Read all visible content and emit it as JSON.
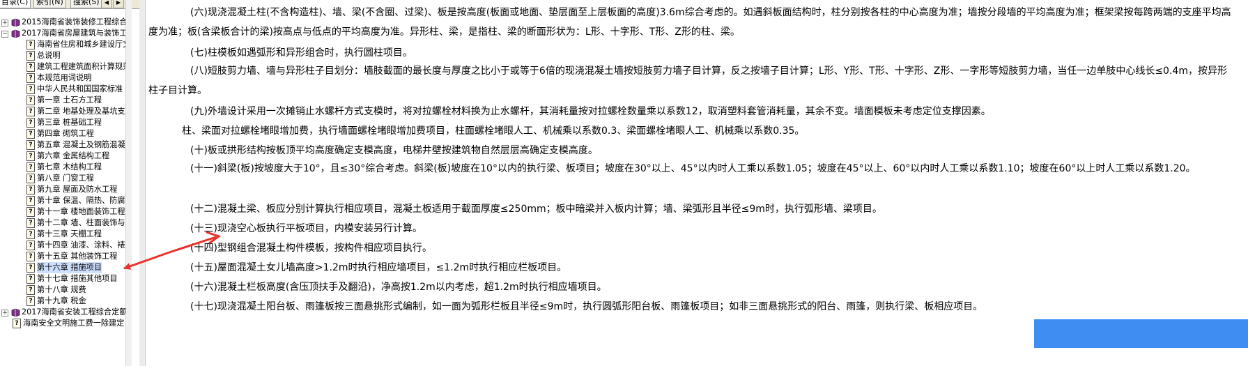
{
  "tabs": [
    "目录(C)",
    "索引(N)",
    "搜索(S)"
  ],
  "tab_nav": [
    "◀",
    "▶"
  ],
  "tree": [
    {
      "expander": "+",
      "icon": "book-icon",
      "label": "2015海南省装饰装修工程综合",
      "indent": 0
    },
    {
      "expander": "−",
      "icon": "book-open-icon",
      "label": "2017海南省房屋建筑与装饰工",
      "indent": 0
    },
    {
      "icon": "help-icon",
      "label": "海南省住房和城乡建设厅文",
      "indent": 1
    },
    {
      "icon": "help-icon",
      "label": "总说明",
      "indent": 1
    },
    {
      "icon": "help-icon",
      "label": "建筑工程建筑面积计算规范",
      "indent": 1
    },
    {
      "icon": "help-icon",
      "label": "本规范用词说明",
      "indent": 1
    },
    {
      "icon": "help-icon",
      "label": "中华人民共和国国家标准",
      "indent": 1
    },
    {
      "icon": "help-icon",
      "label": "第一章 土石方工程",
      "indent": 1
    },
    {
      "icon": "help-icon",
      "label": "第二章 地基处理及基坑支",
      "indent": 1
    },
    {
      "icon": "help-icon",
      "label": "第三章 桩基础工程",
      "indent": 1
    },
    {
      "icon": "help-icon",
      "label": "第四章 砌筑工程",
      "indent": 1
    },
    {
      "icon": "help-icon",
      "label": "第五章 混凝土及钢筋混凝",
      "indent": 1
    },
    {
      "icon": "help-icon",
      "label": "第六章 金属结构工程",
      "indent": 1
    },
    {
      "icon": "help-icon",
      "label": "第七章 木结构工程",
      "indent": 1
    },
    {
      "icon": "help-icon",
      "label": "第八章 门窗工程",
      "indent": 1
    },
    {
      "icon": "help-icon",
      "label": "第九章 屋面及防水工程",
      "indent": 1
    },
    {
      "icon": "help-icon",
      "label": "第十章 保温、隔热、防腐",
      "indent": 1
    },
    {
      "icon": "help-icon",
      "label": "第十一章 楼地面装饰工程",
      "indent": 1
    },
    {
      "icon": "help-icon",
      "label": "第十二章 墙、柱面装饰与",
      "indent": 1
    },
    {
      "icon": "help-icon",
      "label": "第十三章 天棚工程",
      "indent": 1
    },
    {
      "icon": "help-icon",
      "label": "第十四章 油漆、涂料、裱",
      "indent": 1
    },
    {
      "icon": "help-icon",
      "label": "第十五章 其他装饰工程",
      "indent": 1
    },
    {
      "icon": "help-icon",
      "label": "第十六章 措施项目",
      "indent": 1,
      "selected": true
    },
    {
      "icon": "help-icon",
      "label": "第十七章 措施其他项目",
      "indent": 1
    },
    {
      "icon": "help-icon",
      "label": "第十八章 规费",
      "indent": 1
    },
    {
      "icon": "help-icon",
      "label": "第十九章 税金",
      "indent": 1
    },
    {
      "expander": "+",
      "icon": "book-icon",
      "label": "2017海南省安装工程综合定额",
      "indent": 0
    },
    {
      "icon": "help-icon",
      "label": "海南安全文明施工费一除建定",
      "indent": 0
    }
  ],
  "paragraphs": [
    "(六)现浇混凝土柱(不含构造柱)、墙、梁(不含圈、过梁)、板是按高度(板面或地面、垫层面至上层板面的高度)3.6m综合考虑的。如遇斜板面结构时，柱分别按各柱的中心高度为准；墙按分段墙的平均高度为准；框架梁按每跨两端的支座平均高度为准；板(含梁板合计的梁)按高点与低点的平均高度为准。异形柱、梁，是指柱、梁的断面形状为：L形、十字形、T形、Z形的柱、梁。",
    "(七)柱模板如遇弧形和异形组合时，执行圆柱项目。",
    "(八)短肢剪力墙、墙与异形柱子目划分：墙肢截面的最长度与厚度之比小于或等于6倍的现浇混凝土墙按短肢剪力墙子目计算，反之按墙子目计算；L形、Y形、T形、十字形、Z形、一字形等短肢剪力墙，当任一边单肢中心线长≤0.4m，按异形柱子目计算。",
    "(九)外墙设计采用一次摊销止水螺杆方式支模时，将对拉螺栓材料换为止水螺杆，其消耗量按对拉螺栓数量乘以系数12，取消塑料套管消耗量，其余不变。墙面模板未考虑定位支撑因素。",
    "柱、梁面对拉螺栓堵眼增加费，执行墙面螺栓堵眼增加费项目，柱面螺栓堵眼人工、机械乘以系数0.3、梁面螺栓堵眼人工、机械乘以系数0.35。",
    "(十)板或拱形结构按板顶平均高度确定支模高度，电梯井壁按建筑物自然层层高确定支模高度。",
    "(十一)斜梁(板)按坡度大于10°，且≤30°综合考虑。斜梁(板)坡度在10°以内的执行梁、板项目；坡度在30°以上、45°以内时人工乘以系数1.05；坡度在45°以上、60°以内时人工乘以系数1.10；坡度在60°以上时人工乘以系数1.20。",
    "(十二)混凝土梁、板应分别计算执行相应项目，混凝土板适用于截面厚度≤250mm；板中暗梁并入板内计算；墙、梁弧形且半径≤9m时，执行弧形墙、梁项目。",
    "(十三)现浇空心板执行平板项目，内模安装另行计算。",
    "(十四)型钢组合混凝土构件模板，按构件相应项目执行。",
    "(十五)屋面混凝土女儿墙高度>1.2m时执行相应墙项目，≤1.2m时执行相应栏板项目。",
    "(十六)混凝土栏板高度(含压顶扶手及翻沿)，净高按1.2m以内考虑，超1.2m时执行相应墙项目。",
    "(十七)现浇混凝土阳台板、雨篷板按三面悬挑形式编制，如一面为弧形栏板且半径≤9m时，执行圆弧形阳台板、雨篷板项目；如非三面悬挑形式的阳台、雨篷，则执行梁、板相应项目。"
  ],
  "colors": {
    "arrow": "#e8322b",
    "overlay": "#3f8cf2",
    "selection": "#cfe0ff"
  }
}
